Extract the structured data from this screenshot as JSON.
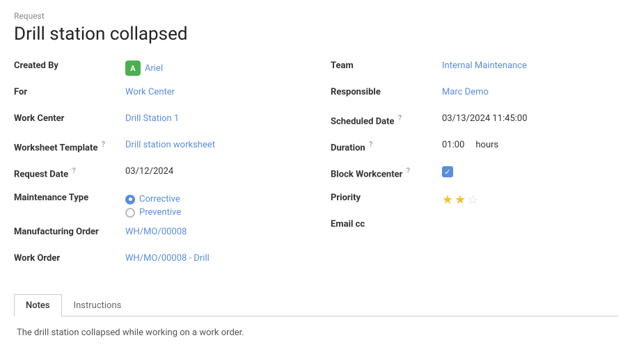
{
  "breadcrumb": "Request",
  "title": "Drill station collapsed",
  "left": {
    "created_by_label": "Created By",
    "created_by_avatar": "A",
    "created_by_name": "Ariel",
    "for_label": "For",
    "for_value": "Work Center",
    "work_center_label": "Work Center",
    "work_center_value": "Drill Station 1",
    "worksheet_template_label": "Worksheet Template",
    "worksheet_template_help": "?",
    "worksheet_template_value": "Drill station worksheet",
    "request_date_label": "Request Date",
    "request_date_help": "?",
    "request_date_value": "03/12/2024",
    "maintenance_type_label": "Maintenance Type",
    "corrective_label": "Corrective",
    "preventive_label": "Preventive",
    "manufacturing_order_label": "Manufacturing Order",
    "manufacturing_order_value": "WH/MO/00008",
    "work_order_label": "Work Order",
    "work_order_value": "WH/MO/00008 - Drill"
  },
  "right": {
    "team_label": "Team",
    "team_value": "Internal Maintenance",
    "responsible_label": "Responsible",
    "responsible_value": "Marc Demo",
    "scheduled_date_label": "Scheduled Date",
    "scheduled_date_help": "?",
    "scheduled_date_value": "03/13/2024 11:45:00",
    "duration_label": "Duration",
    "duration_help": "?",
    "duration_value": "01:00",
    "duration_unit": "hours",
    "block_workcenter_label": "Block Workcenter",
    "block_workcenter_help": "?",
    "priority_label": "Priority",
    "email_cc_label": "Email cc"
  },
  "tabs": {
    "notes_label": "Notes",
    "instructions_label": "Instructions"
  },
  "tab_content": "The drill station collapsed while working on a work order.",
  "icons": {
    "checkbox_check": "✓",
    "star_filled": "★",
    "star_empty": "☆"
  }
}
